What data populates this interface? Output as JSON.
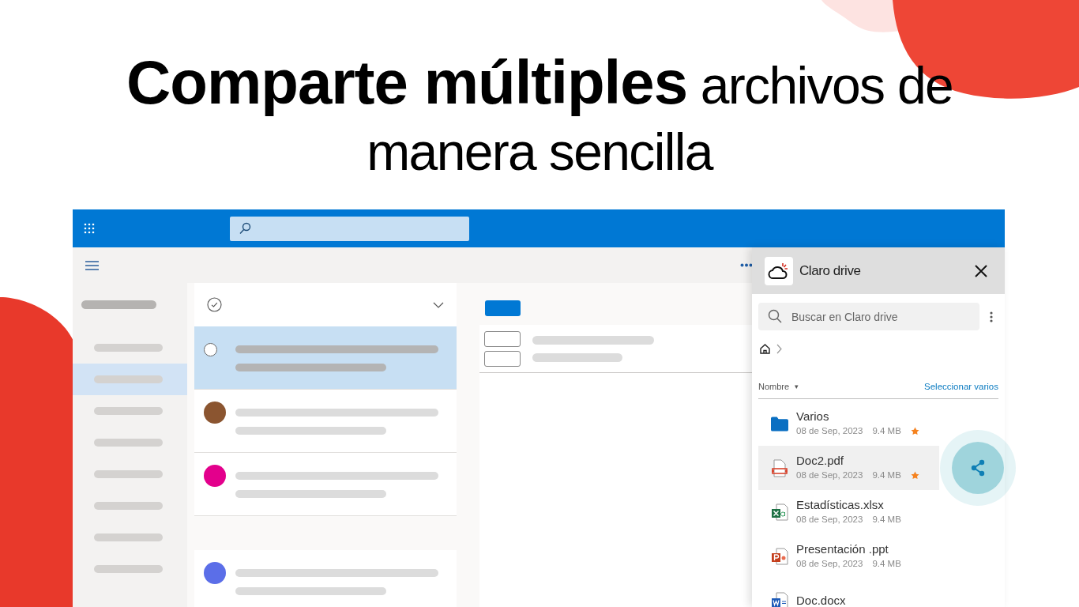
{
  "headline": "**Comparte múltiples** archivos de manera sencilla",
  "nav_items": [
    {
      "selected": false
    },
    {
      "selected": true
    },
    {
      "selected": false
    },
    {
      "selected": false
    },
    {
      "selected": false
    },
    {
      "selected": false
    },
    {
      "selected": false
    },
    {
      "selected": false
    }
  ],
  "messages": [
    {
      "kind": "radio",
      "selected": true
    },
    {
      "kind": "avatar",
      "selected": false,
      "color": "#8b5530"
    },
    {
      "kind": "avatar",
      "selected": false,
      "color": "#e3008c"
    },
    {
      "kind": "gap",
      "selected": false
    },
    {
      "kind": "avatar",
      "selected": false,
      "color": "#5b6ee8"
    }
  ],
  "drive": {
    "title": "Claro drive",
    "search": {
      "placeholder": "Buscar en Claro drive"
    },
    "sort_label": "Nombre",
    "sort_caret": "▾",
    "select_link": "Seleccionar varios",
    "files": [
      {
        "kind": "folder",
        "name": "Varios",
        "date": "08 de Sep, 2023",
        "size": "9.4 MB",
        "starred": true,
        "selected": false
      },
      {
        "kind": "pdf",
        "name": "Doc2.pdf",
        "date": "08 de Sep, 2023",
        "size": "9.4 MB",
        "starred": true,
        "selected": true
      },
      {
        "kind": "xlsx",
        "name": "Estadísticas.xlsx",
        "date": "08 de Sep, 2023",
        "size": "9.4 MB",
        "starred": false,
        "selected": false
      },
      {
        "kind": "ppt",
        "name": "Presentación .ppt",
        "date": "08 de Sep, 2023",
        "size": "9.4 MB",
        "starred": false,
        "selected": false
      },
      {
        "kind": "docx",
        "name": "Doc.docx",
        "starred": false,
        "selected": false
      }
    ]
  }
}
